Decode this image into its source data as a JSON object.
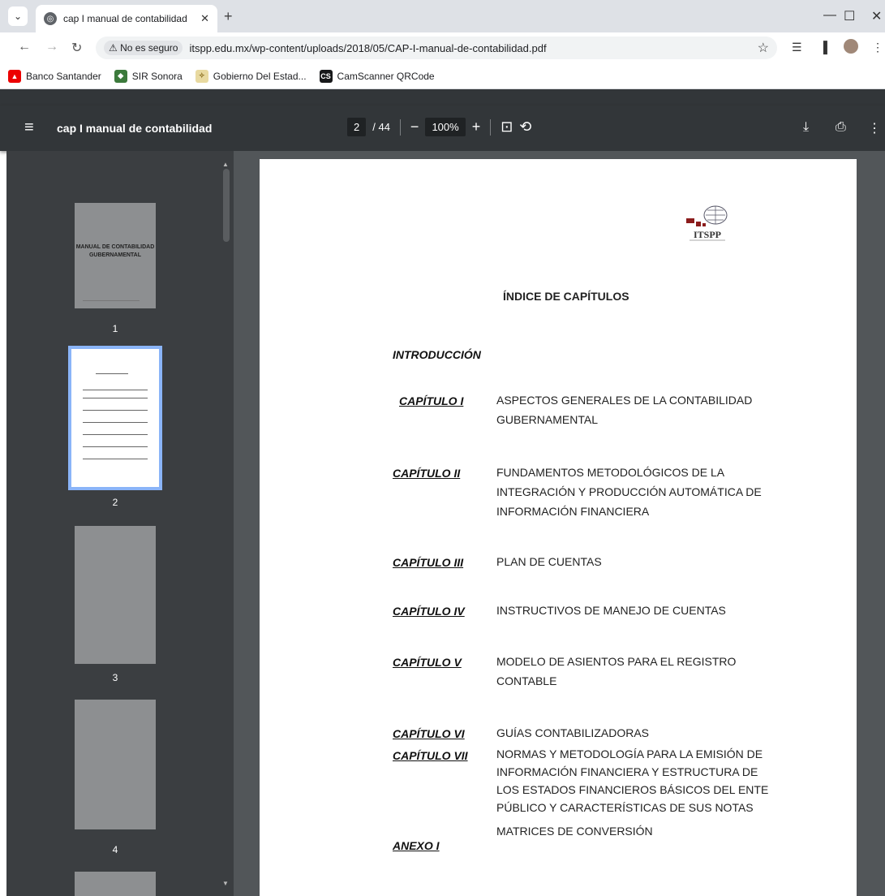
{
  "browser": {
    "tab_title": "cap I manual de contabilidad",
    "new_tab": "+",
    "not_secure": "No es seguro",
    "url": "itspp.edu.mx/wp-content/uploads/2018/05/CAP-I-manual-de-contabilidad.pdf"
  },
  "bookmarks": [
    {
      "label": "Banco Santander"
    },
    {
      "label": "SIR Sonora"
    },
    {
      "label": "Gobierno Del Estad..."
    },
    {
      "label": "CamScanner QRCode"
    }
  ],
  "viewer": {
    "doc_title": "cap I manual de contabilidad",
    "page": "2",
    "total": "/ 44",
    "zoom": "100%"
  },
  "thumbnails": [
    {
      "num": "1",
      "title": "MANUAL DE CONTABILIDAD GUBERNAMENTAL"
    },
    {
      "num": "2"
    },
    {
      "num": "3"
    },
    {
      "num": "4"
    }
  ],
  "document": {
    "logo_text": "ITSPP",
    "title": "ÍNDICE DE CAPÍTULOS",
    "intro": "INTRODUCCIÓN",
    "chapters": [
      {
        "label": "CAPÍTULO I",
        "desc": "ASPECTOS GENERALES DE LA CONTABILIDAD GUBERNAMENTAL"
      },
      {
        "label": "CAPÍTULO II",
        "desc": "FUNDAMENTOS METODOLÓGICOS DE LA INTEGRACIÓN Y PRODUCCIÓN AUTOMÁTICA DE INFORMACIÓN FINANCIERA"
      },
      {
        "label": "CAPÍTULO III",
        "desc": "PLAN DE CUENTAS"
      },
      {
        "label": "CAPÍTULO IV",
        "desc": "INSTRUCTIVOS DE MANEJO DE CUENTAS"
      },
      {
        "label": "CAPÍTULO V",
        "desc": "MODELO DE ASIENTOS PARA EL REGISTRO CONTABLE"
      },
      {
        "label": "CAPÍTULO VI",
        "desc": "GUÍAS CONTABILIZADORAS"
      },
      {
        "label": "CAPÍTULO VII",
        "desc": "NORMAS Y METODOLOGÍA PARA LA EMISIÓN DE INFORMACIÓN FINANCIERA Y ESTRUCTURA DE LOS ESTADOS FINANCIEROS BÁSICOS DEL ENTE PÚBLICO Y CARACTERÍSTICAS DE SUS NOTAS"
      },
      {
        "label": "ANEXO I",
        "desc": "MATRICES DE CONVERSIÓN"
      }
    ]
  }
}
